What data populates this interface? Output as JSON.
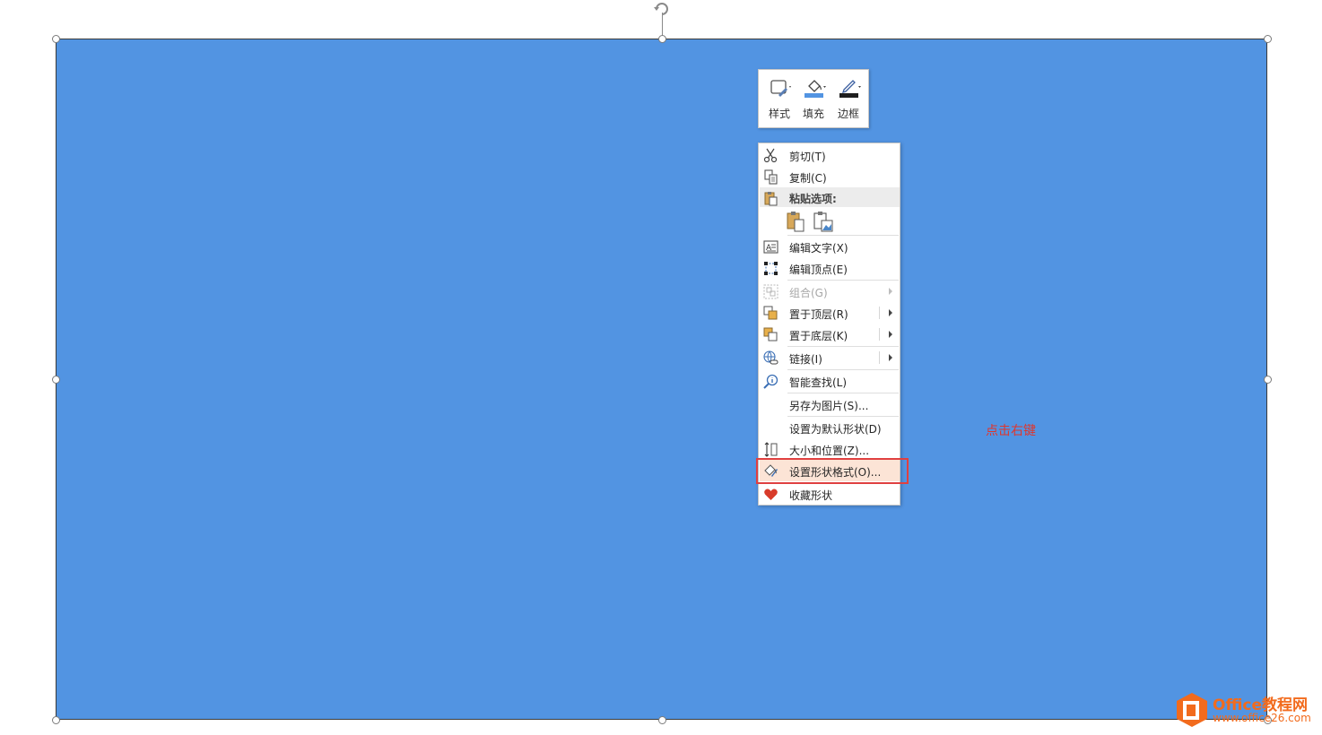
{
  "mini_toolbar": {
    "style_label": "样式",
    "fill_label": "填充",
    "border_label": "边框",
    "colors": {
      "fill": "#5294e2",
      "border": "#1f1f1f"
    }
  },
  "context_menu": {
    "cut": "剪切(T)",
    "copy": "复制(C)",
    "paste_options": "粘贴选项:",
    "edit_text": "编辑文字(X)",
    "edit_points": "编辑顶点(E)",
    "group": "组合(G)",
    "bring_to_front": "置于顶层(R)",
    "send_to_back": "置于底层(K)",
    "link": "链接(I)",
    "smart_lookup": "智能查找(L)",
    "save_as_picture": "另存为图片(S)...",
    "set_default_shape": "设置为默认形状(D)",
    "size_position": "大小和位置(Z)...",
    "format_shape": "设置形状格式(O)...",
    "favorite_shape": "收藏形状"
  },
  "annotation": "点击右键",
  "watermark": {
    "name": "Office教程网",
    "url": "www.office26.com"
  },
  "colors": {
    "shape_fill": "#5294e2",
    "highlight": "#fce4d6",
    "annotation": "#e0352b",
    "red_box": "#e04040"
  }
}
